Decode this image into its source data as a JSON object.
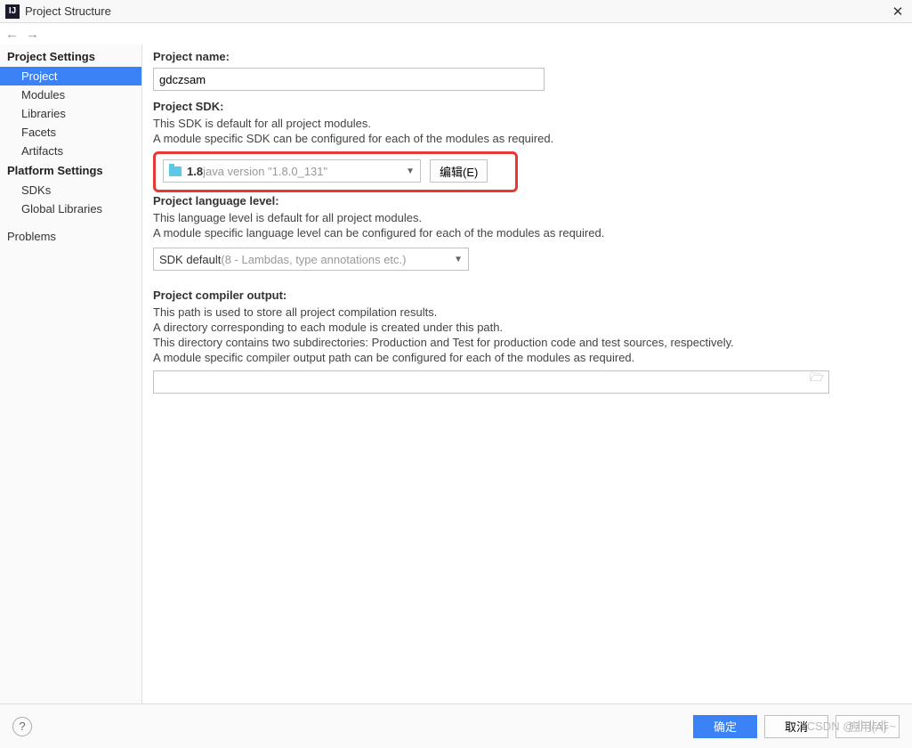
{
  "window": {
    "title": "Project Structure",
    "app_icon_text": "IJ"
  },
  "sidebar": {
    "heading1": "Project Settings",
    "items1": [
      "Project",
      "Modules",
      "Libraries",
      "Facets",
      "Artifacts"
    ],
    "selected": "Project",
    "heading2": "Platform Settings",
    "items2": [
      "SDKs",
      "Global Libraries"
    ],
    "heading3": "",
    "items3": [
      "Problems"
    ]
  },
  "project_name": {
    "label": "Project name:",
    "value": "gdczsam"
  },
  "project_sdk": {
    "label": "Project SDK:",
    "desc1": "This SDK is default for all project modules.",
    "desc2": "A module specific SDK can be configured for each of the modules as required.",
    "combo_strong": "1.8",
    "combo_gray": " java version \"1.8.0_131\"",
    "edit_btn": "编辑(E)"
  },
  "lang_level": {
    "label": "Project language level:",
    "desc1": "This language level is default for all project modules.",
    "desc2": "A module specific language level can be configured for each of the modules as required.",
    "combo_text": "SDK default ",
    "combo_gray": "(8 - Lambdas, type annotations etc.)"
  },
  "compiler_out": {
    "label": "Project compiler output:",
    "desc1": "This path is used to store all project compilation results.",
    "desc2": "A directory corresponding to each module is created under this path.",
    "desc3": "This directory contains two subdirectories: Production and Test for production code and test sources, respectively.",
    "desc4": "A module specific compiler output path can be configured for each of the modules as required.",
    "value": ""
  },
  "footer": {
    "ok": "确定",
    "cancel": "取消",
    "apply": "应用(A)"
  },
  "watermark": "CSDN @非非非~"
}
